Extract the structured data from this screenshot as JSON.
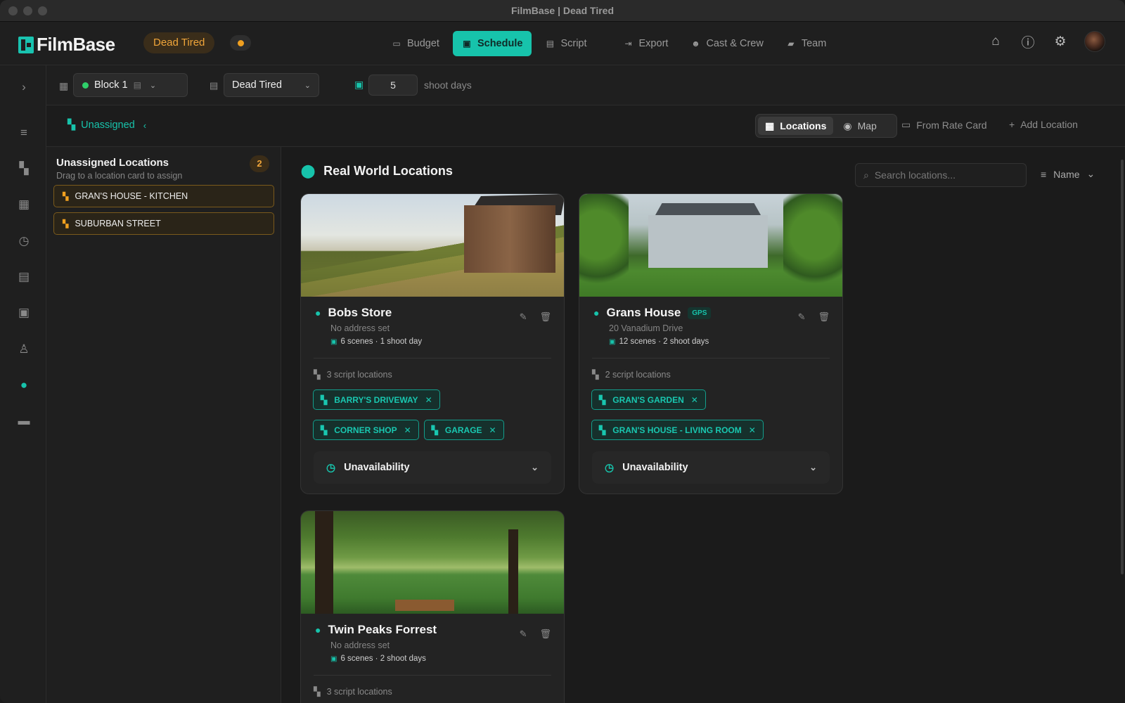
{
  "window": {
    "title": "FilmBase | Dead Tired"
  },
  "app": {
    "logo_text": "FilmBase",
    "project_name": "Dead Tired",
    "status_color": "#f0a020",
    "accent": "#17c3ab"
  },
  "nav": {
    "tabs": [
      {
        "label": "Budget",
        "icon": "budget-icon"
      },
      {
        "label": "Schedule",
        "icon": "calendar-icon",
        "active": true
      },
      {
        "label": "Script",
        "icon": "script-icon"
      },
      {
        "label": "Export",
        "icon": "export-icon"
      },
      {
        "label": "Cast & Crew",
        "icon": "people-icon"
      },
      {
        "label": "Team",
        "icon": "chat-icon"
      }
    ],
    "right_icons": [
      "home-icon",
      "help-icon",
      "gear-icon",
      "avatar"
    ]
  },
  "rail": {
    "icons": [
      "expand-chevron-icon",
      "list-icon",
      "clapper-icon",
      "clipboard-icon",
      "clock-calendar-icon",
      "calendar-icon",
      "calendar-stack-icon",
      "person-badge-icon",
      "location-pin-icon",
      "car-icon"
    ],
    "active": "location-pin-icon"
  },
  "toolbar": {
    "block_label": "Block 1",
    "script_label": "Dead Tired",
    "shoot_days_value": "5",
    "shoot_days_label": "shoot days"
  },
  "subbar": {
    "unassigned_label": "Unassigned",
    "view_locations": "Locations",
    "view_map": "Map",
    "from_rate_card": "From Rate Card",
    "add_location": "Add Location"
  },
  "unassigned_panel": {
    "title": "Unassigned Locations",
    "subtitle": "Drag to a location card to assign",
    "count": "2",
    "items": [
      "GRAN'S HOUSE - KITCHEN",
      "SUBURBAN STREET"
    ]
  },
  "main": {
    "section_title": "Real World Locations",
    "search_placeholder": "Search locations...",
    "sort_label": "Name"
  },
  "cards": [
    {
      "name": "Bobs Store",
      "gps": "",
      "address": "No address set",
      "meta": "6 scenes · 1 shoot day",
      "script_locations_label": "3 script locations",
      "tags": [
        "BARRY'S DRIVEWAY",
        "CORNER SHOP",
        "GARAGE"
      ],
      "unavailability": "Unavailability"
    },
    {
      "name": "Grans House",
      "gps": "GPS",
      "address": "20 Vanadium Drive",
      "meta": "12 scenes · 2 shoot days",
      "script_locations_label": "2 script locations",
      "tags": [
        "GRAN'S GARDEN",
        "GRAN'S HOUSE - LIVING ROOM"
      ],
      "unavailability": "Unavailability"
    },
    {
      "name": "Twin Peaks Forrest",
      "gps": "",
      "address": "No address set",
      "meta": "6 scenes · 2 shoot days",
      "script_locations_label": "3 script locations",
      "tags": [],
      "unavailability": ""
    }
  ]
}
